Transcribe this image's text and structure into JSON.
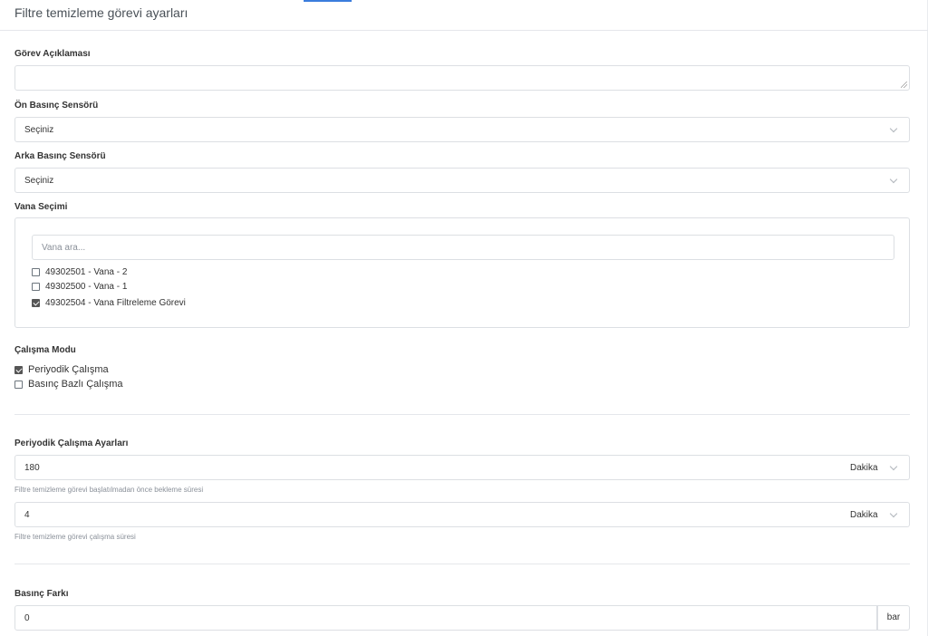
{
  "header": {
    "title": "Filtre temizleme görevi ayarları"
  },
  "task_description": {
    "label": "Görev Açıklaması",
    "value": ""
  },
  "front_pressure_sensor": {
    "label": "Ön Basınç Sensörü",
    "selected": "Seçiniz"
  },
  "rear_pressure_sensor": {
    "label": "Arka Basınç Sensörü",
    "selected": "Seçiniz"
  },
  "valve_selection": {
    "label": "Vana Seçimi",
    "search_placeholder": "Vana ara...",
    "items": [
      {
        "label": "49302501 - Vana - 2",
        "checked": false
      },
      {
        "label": "49302500 - Vana - 1",
        "checked": false
      },
      {
        "label": "49302504 - Vana Filtreleme Görevi",
        "checked": true
      }
    ]
  },
  "work_mode": {
    "label": "Çalışma Modu",
    "options": [
      {
        "label": "Periyodik Çalışma",
        "checked": true
      },
      {
        "label": "Basınç Bazlı Çalışma",
        "checked": false
      }
    ]
  },
  "periodic_settings": {
    "label": "Periyodik Çalışma Ayarları",
    "wait": {
      "value": "180",
      "unit": "Dakika",
      "help": "Filtre temizleme görevi başlatılmadan önce bekleme süresi"
    },
    "duration": {
      "value": "4",
      "unit": "Dakika",
      "help": "Filtre temizleme görevi çalışma süresi"
    }
  },
  "pressure_diff": {
    "label": "Basınç Farkı",
    "value": "0",
    "unit": "bar"
  },
  "colors": {
    "accent": "#3b7ddd",
    "border": "#dcdfe3",
    "muted_text": "#8a9099"
  }
}
